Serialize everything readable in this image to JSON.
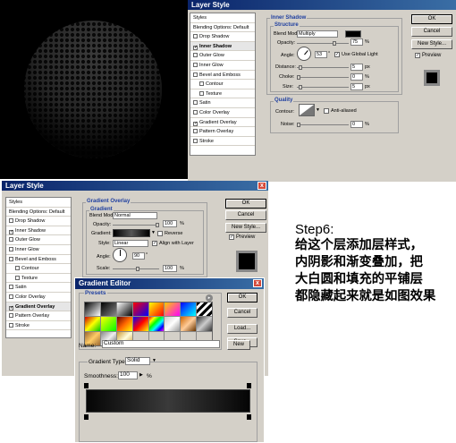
{
  "dialog1": {
    "title": "Layer Style",
    "styles_list": [
      "Styles",
      "Blending Options: Default",
      "Drop Shadow",
      "Inner Shadow",
      "Outer Glow",
      "Inner Glow",
      "Bevel and Emboss",
      "Contour",
      "Texture",
      "Satin",
      "Color Overlay",
      "Gradient Overlay",
      "Pattern Overlay",
      "Stroke"
    ],
    "inner_shadow": {
      "section_title": "Inner Shadow",
      "structure_title": "Structure",
      "blend_mode_label": "Blend Mode:",
      "blend_mode_value": "Multiply",
      "opacity_label": "Opacity:",
      "opacity_value": "75",
      "angle_label": "Angle:",
      "angle_value": "53",
      "global_light_label": "Use Global Light",
      "distance_label": "Distance:",
      "distance_value": "5",
      "choke_label": "Choke:",
      "choke_value": "0",
      "size_label": "Size:",
      "size_value": "5",
      "quality_title": "Quality",
      "contour_label": "Contour:",
      "antialiased_label": "Anti-aliased",
      "noise_label": "Noise:",
      "noise_value": "0",
      "pct": "%",
      "px": "px",
      "deg": "°"
    },
    "buttons": {
      "ok": "OK",
      "cancel": "Cancel",
      "new_style": "New Style...",
      "preview": "Preview"
    }
  },
  "dialog2": {
    "title": "Layer Style",
    "styles_list": [
      "Styles",
      "Blending Options: Default",
      "Drop Shadow",
      "Inner Shadow",
      "Outer Glow",
      "Inner Glow",
      "Bevel and Emboss",
      "Contour",
      "Texture",
      "Satin",
      "Color Overlay",
      "Gradient Overlay",
      "Pattern Overlay",
      "Stroke"
    ],
    "gradient_overlay": {
      "section_title": "Gradient Overlay",
      "gradient_title": "Gradient",
      "blend_mode_label": "Blend Mode:",
      "blend_mode_value": "Normal",
      "opacity_label": "Opacity:",
      "opacity_value": "100",
      "gradient_label": "Gradient:",
      "reverse_label": "Reverse",
      "style_label": "Style:",
      "style_value": "Linear",
      "align_label": "Align with Layer",
      "angle_label": "Angle:",
      "angle_value": "90",
      "scale_label": "Scale:",
      "scale_value": "100",
      "pct": "%",
      "deg": "°"
    },
    "buttons": {
      "ok": "OK",
      "cancel": "Cancel",
      "new_style": "New Style...",
      "preview": "Preview"
    }
  },
  "gradient_editor": {
    "title": "Gradient Editor",
    "presets_label": "Presets",
    "name_label": "Name:",
    "name_value": "Custom",
    "new_button": "New",
    "gradient_type_label": "Gradient Type:",
    "gradient_type_value": "Solid",
    "smoothness_label": "Smoothness:",
    "smoothness_value": "100",
    "pct": "%",
    "buttons": {
      "ok": "OK",
      "cancel": "Cancel",
      "load": "Load...",
      "save": "Save..."
    }
  },
  "tutorial": {
    "step": "Step6:",
    "lines": [
      "给这个层添加层样式，",
      "内阴影和渐变叠加，把",
      "大白圆和填充的平铺层",
      "都隐藏起来就是如图效果"
    ]
  },
  "colors": {
    "titlebar": "#0a246a",
    "panel": "#d4d0c8",
    "canvas": "#000000"
  }
}
